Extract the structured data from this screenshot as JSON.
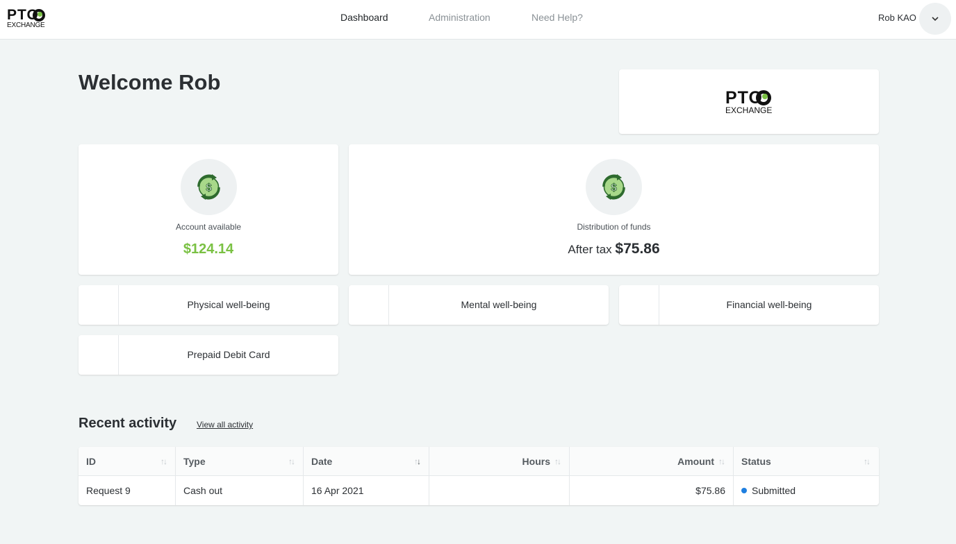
{
  "header": {
    "logo_top": "PTO",
    "logo_bottom": "EXCHANGE",
    "nav": [
      {
        "label": "Dashboard",
        "active": true
      },
      {
        "label": "Administration",
        "active": false
      },
      {
        "label": "Need Help?",
        "active": false
      }
    ],
    "user_name": "Rob KAO"
  },
  "welcome": {
    "title": "Welcome Rob",
    "company_logo_top": "PTO",
    "company_logo_bottom": "EXCHANGE"
  },
  "account": {
    "label": "Account available",
    "amount": "$124.14"
  },
  "distribution": {
    "label": "Distribution of funds",
    "prefix": "After tax",
    "amount": "$75.86"
  },
  "tiles": [
    {
      "label": "Physical well-being"
    },
    {
      "label": "Mental well-being"
    },
    {
      "label": "Financial well-being"
    },
    {
      "label": "Prepaid Debit Card"
    }
  ],
  "recent": {
    "title": "Recent activity",
    "view_all": "View all activity",
    "columns": [
      "ID",
      "Type",
      "Date",
      "Hours",
      "Amount",
      "Status"
    ],
    "rows": [
      {
        "id": "Request 9",
        "type": "Cash out",
        "date": "16 Apr 2021",
        "hours": "",
        "amount": "$75.86",
        "status": "Submitted",
        "status_color": "#1f7fe0"
      }
    ]
  },
  "colors": {
    "accent_green": "#7ac143",
    "status_blue": "#1f7fe0"
  },
  "icons": [
    "chevron-down-icon",
    "money-exchange-icon",
    "sort-icon"
  ]
}
